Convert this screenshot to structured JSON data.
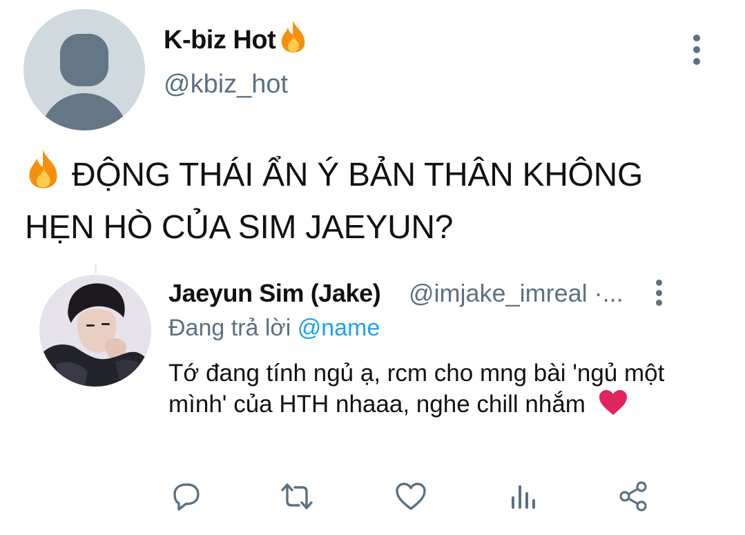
{
  "tweet": {
    "author": {
      "display_name": "K-biz Hot",
      "emoji": "fire-icon",
      "handle": "@kbiz_hot"
    },
    "headline_line1": "ĐỘNG THÁI ẨN Ý BẢN THÂN KHÔNG",
    "headline_line2": "HẸN HÒ CỦA SIM JAEYUN?"
  },
  "reply": {
    "display_name": "Jaeyun Sim (Jake)",
    "handle": "@imjake_imreal ·...",
    "replying_label": "Đang trả lời",
    "replying_to": "@name",
    "body_text": "Tớ đang tính ngủ ạ, rcm cho mng bài 'ngủ một mình' của HTH nhaaa, nghe chill nhắm"
  },
  "actions": [
    {
      "icon": "reply-icon"
    },
    {
      "icon": "retweet-icon"
    },
    {
      "icon": "like-icon"
    },
    {
      "icon": "analytics-icon"
    },
    {
      "icon": "share-icon"
    }
  ],
  "colors": {
    "secondary_text": "#5b7083",
    "link": "#1da1f2",
    "placeholder_avatar": "#cfd9de",
    "heart": "#e0245e"
  }
}
